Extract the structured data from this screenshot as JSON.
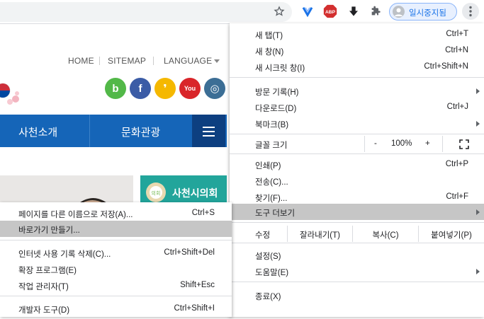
{
  "toolbar": {
    "profile_label": "일시중지됨",
    "icons": [
      "star-icon",
      "vivaldi-y-icon",
      "adblock-icon",
      "download-arrow-icon",
      "extensions-puzzle-icon",
      "profile-icon",
      "more-vert-icon"
    ],
    "abp_text": "ABP"
  },
  "site": {
    "links": [
      "HOME",
      "SITEMAP",
      "LANGUAGE"
    ],
    "social": [
      {
        "name": "blog",
        "glyph": "b",
        "color": "#52b848"
      },
      {
        "name": "facebook",
        "glyph": "f",
        "color": "#3b5ca6"
      },
      {
        "name": "kakaostory",
        "glyph": "❜",
        "color": "#f5b800"
      },
      {
        "name": "youtube",
        "glyph": "You",
        "color": "#d9252a"
      },
      {
        "name": "instagram",
        "glyph": "◎",
        "color": "#3c6e95"
      }
    ],
    "nav": [
      "사천소개",
      "문화관광"
    ],
    "council_label": "사천시의회",
    "council_badge": "의회"
  },
  "menu": {
    "items": [
      {
        "label": "새 탭(T)",
        "shortcut": "Ctrl+T"
      },
      {
        "label": "새 창(N)",
        "shortcut": "Ctrl+N"
      },
      {
        "label": "새 시크릿 창(I)",
        "shortcut": "Ctrl+Shift+N"
      },
      {
        "label": "방문 기록(H)",
        "shortcut": ""
      },
      {
        "label": "다운로드(D)",
        "shortcut": "Ctrl+J"
      },
      {
        "label": "북마크(B)",
        "shortcut": ""
      },
      {
        "label": "글꼴 크기",
        "shortcut": ""
      },
      {
        "label": "인쇄(P)",
        "shortcut": "Ctrl+P"
      },
      {
        "label": "전송(C)...",
        "shortcut": ""
      },
      {
        "label": "찾기(F)...",
        "shortcut": "Ctrl+F"
      },
      {
        "label": "도구 더보기",
        "shortcut": ""
      },
      {
        "label": "수정",
        "shortcut": ""
      },
      {
        "label": "설정(S)",
        "shortcut": ""
      },
      {
        "label": "도움말(E)",
        "shortcut": ""
      },
      {
        "label": "종료(X)",
        "shortcut": ""
      }
    ],
    "zoom": {
      "minus": "-",
      "value": "100%",
      "plus": "+"
    },
    "edit": {
      "cut": "잘라내기(T)",
      "copy": "복사(C)",
      "paste": "붙여넣기(P)"
    }
  },
  "submenu": {
    "items": [
      {
        "label": "페이지를 다른 이름으로 저장(A)...",
        "shortcut": "Ctrl+S"
      },
      {
        "label": "바로가기 만들기...",
        "shortcut": ""
      },
      {
        "label": "인터넷 사용 기록 삭제(C)...",
        "shortcut": "Ctrl+Shift+Del"
      },
      {
        "label": "확장 프로그램(E)",
        "shortcut": ""
      },
      {
        "label": "작업 관리자(T)",
        "shortcut": "Shift+Esc"
      },
      {
        "label": "개발자 도구(D)",
        "shortcut": "Ctrl+Shift+I"
      }
    ]
  },
  "colors": {
    "accent": "#1a73e8",
    "nav": "#1565b8",
    "highlight": "#c6c6c6"
  }
}
